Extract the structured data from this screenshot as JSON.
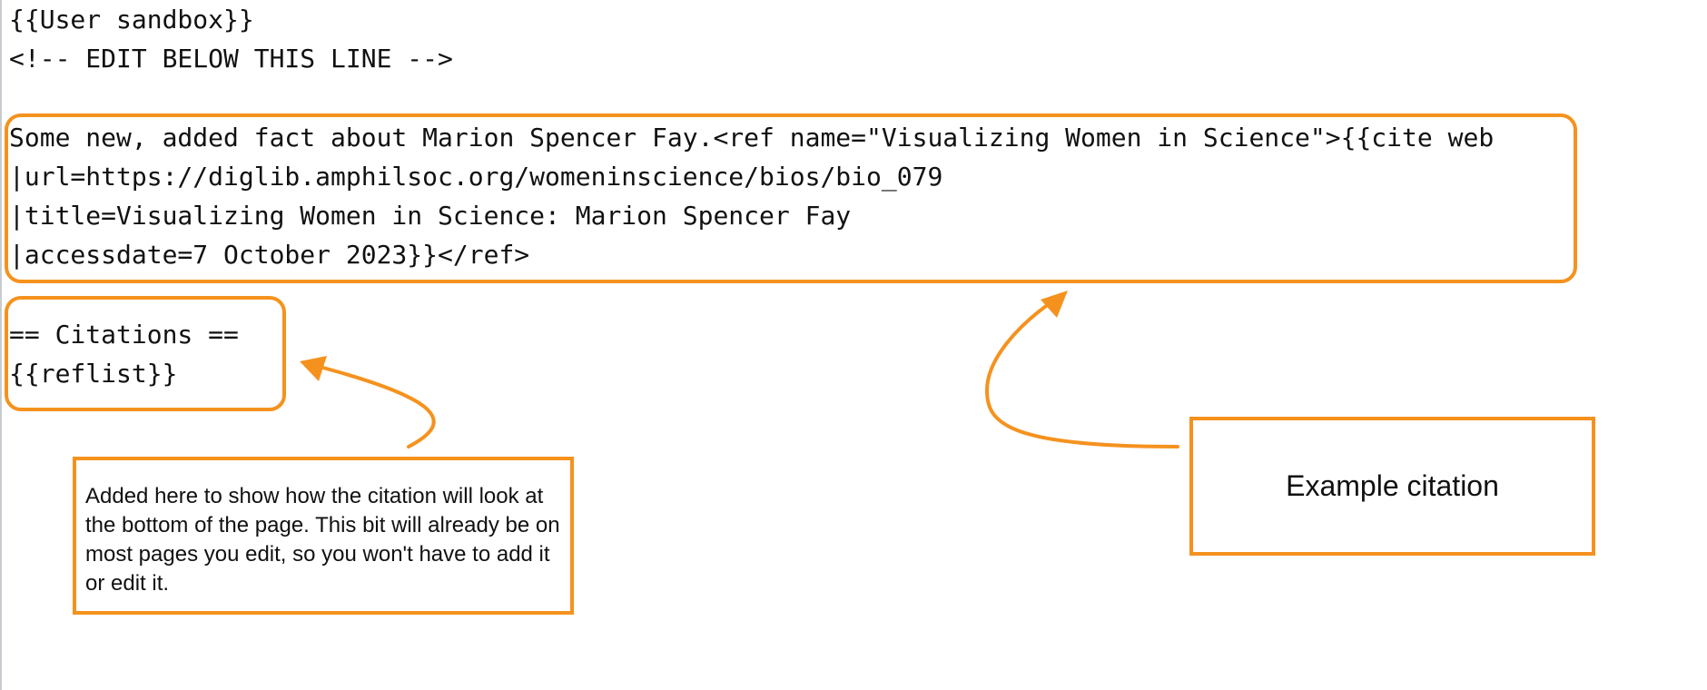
{
  "editor": {
    "lines_header": [
      "{{User sandbox}}",
      "<!-- EDIT BELOW THIS LINE -->"
    ],
    "lines_citation": [
      "Some new, added fact about Marion Spencer Fay.<ref name=\"Visualizing Women in Science\">{{cite web",
      "|url=https://diglib.amphilsoc.org/womeninscience/bios/bio_079",
      "|title=Visualizing Women in Science: Marion Spencer Fay",
      "|accessdate=7 October 2023}}</ref>"
    ],
    "lines_reflist": [
      "== Citations ==",
      "{{reflist}}"
    ]
  },
  "annotations": {
    "reflist_note": "Added here to show how the citation will look at the bottom of the page. This bit will already be on most pages you edit, so you won't have to add it or edit it.",
    "example_label": "Example citation"
  },
  "colors": {
    "accent": "#f5921e",
    "text": "#111111",
    "border": "#c8ccd1"
  }
}
